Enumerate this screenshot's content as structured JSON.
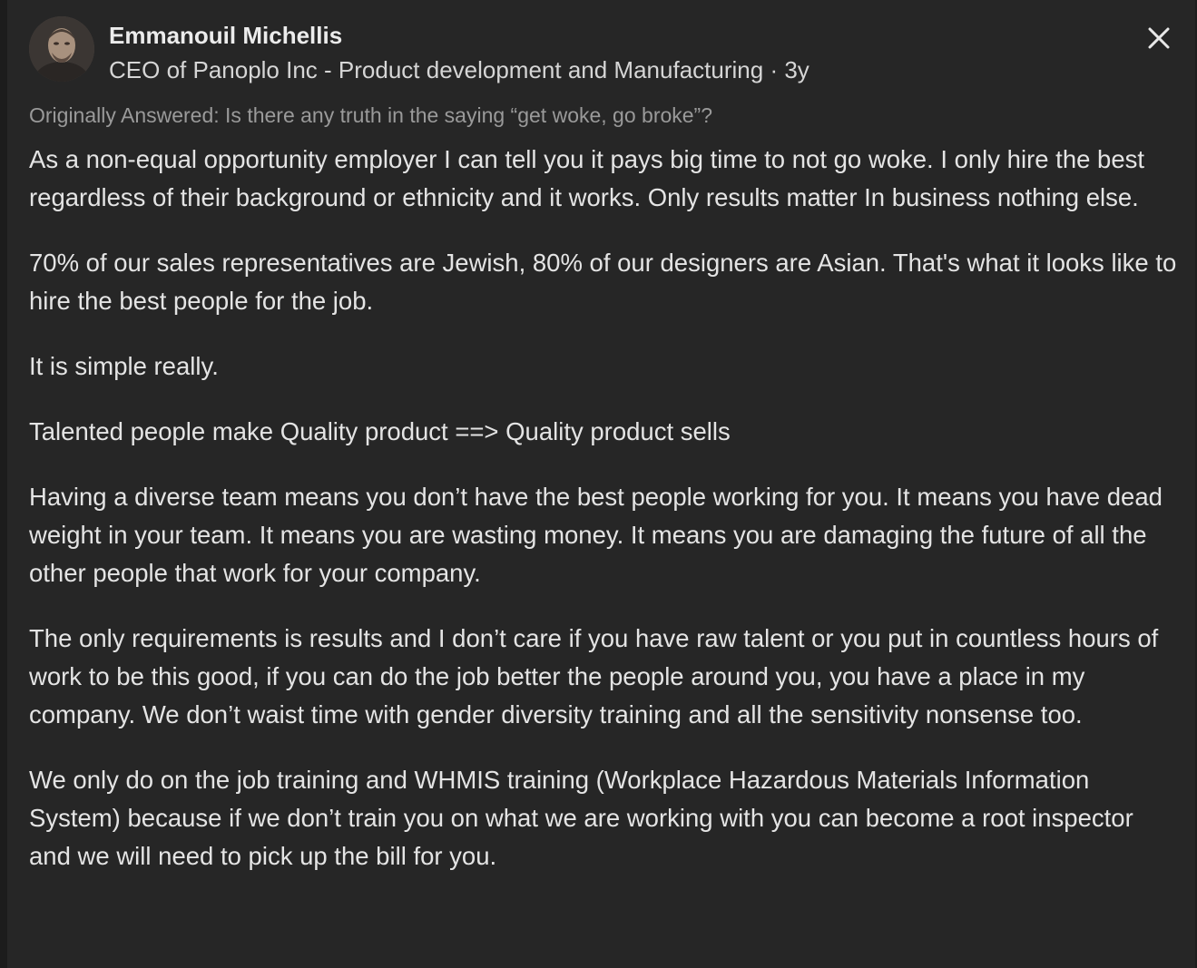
{
  "author": {
    "name": "Emmanouil Michellis",
    "credential": "CEO of Panoplo Inc - Product development and Manufacturing",
    "separator": "·",
    "timestamp": "3y",
    "avatar_icon": "user-avatar-photo"
  },
  "close_icon": "close-icon",
  "question": {
    "prefix": "Originally Answered:",
    "text": "Is there any truth in the saying “get woke, go broke”?"
  },
  "answer": {
    "paragraphs": [
      "As a non-equal opportunity employer I can tell you it pays big time to not go woke. I only hire the best regardless of their background or ethnicity and it works. Only results matter In business nothing else.",
      "70% of our sales representatives are Jewish, 80% of our designers are Asian. That's what it looks like to hire the best people for the job.",
      "It is simple really.",
      "Talented people make Quality product ==> Quality product sells",
      "Having a diverse team means you don’t have the best people working for you. It means you have dead weight in your team. It means you are wasting money. It means you are damaging the future of all the other people that work for your company.",
      "The only requirements is results and I don’t care if you have raw talent or you put in countless hours of work to be this good, if you can do the job better the people around you, you have a place in my company. We don’t waist time with gender diversity training and all the sensitivity nonsense too.",
      "We only do on the job training and WHMIS training (Workplace Hazardous Materials Information System) because if we don’t train you on what we are working with you can become a root inspector and we will need to pick up the bill for you."
    ]
  }
}
